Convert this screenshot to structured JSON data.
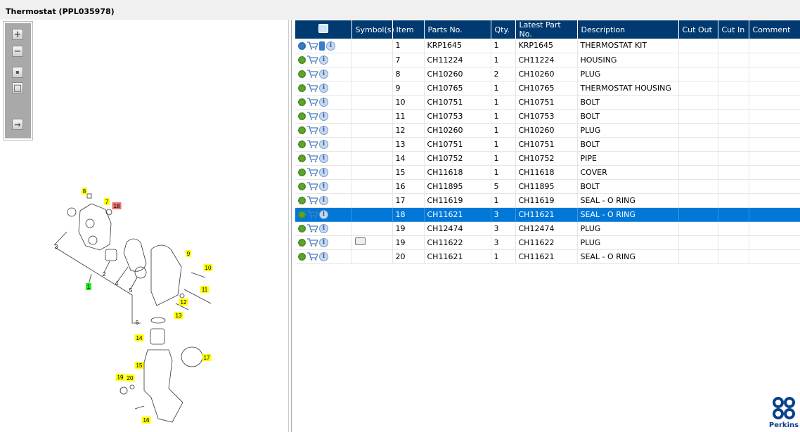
{
  "window": {
    "title": "Thermostat (PPL035978)"
  },
  "toolbar": {
    "buttons": [
      {
        "name": "zoom-in",
        "glyph": "+"
      },
      {
        "name": "zoom-out",
        "glyph": "−"
      },
      {
        "name": "fit",
        "glyph": "▪"
      },
      {
        "name": "actual-size",
        "glyph": "□"
      },
      {
        "name": "export",
        "glyph": "→"
      }
    ]
  },
  "grid": {
    "columns": [
      "",
      "Symbol(s)",
      "Item",
      "Parts No.",
      "Qty.",
      "Latest Part No.",
      "Description",
      "Cut Out",
      "Cut In",
      "Comment"
    ],
    "rows": [
      {
        "item": "1",
        "part": "KRP1645",
        "qty": "1",
        "latest": "KRP1645",
        "desc": "THERMOSTAT KIT",
        "kit": true
      },
      {
        "item": "7",
        "part": "CH11224",
        "qty": "1",
        "latest": "CH11224",
        "desc": "HOUSING"
      },
      {
        "item": "8",
        "part": "CH10260",
        "qty": "2",
        "latest": "CH10260",
        "desc": "PLUG"
      },
      {
        "item": "9",
        "part": "CH10765",
        "qty": "1",
        "latest": "CH10765",
        "desc": "THERMOSTAT HOUSING"
      },
      {
        "item": "10",
        "part": "CH10751",
        "qty": "1",
        "latest": "CH10751",
        "desc": "BOLT"
      },
      {
        "item": "11",
        "part": "CH10753",
        "qty": "1",
        "latest": "CH10753",
        "desc": "BOLT"
      },
      {
        "item": "12",
        "part": "CH10260",
        "qty": "1",
        "latest": "CH10260",
        "desc": "PLUG"
      },
      {
        "item": "13",
        "part": "CH10751",
        "qty": "1",
        "latest": "CH10751",
        "desc": "BOLT"
      },
      {
        "item": "14",
        "part": "CH10752",
        "qty": "1",
        "latest": "CH10752",
        "desc": "PIPE"
      },
      {
        "item": "15",
        "part": "CH11618",
        "qty": "1",
        "latest": "CH11618",
        "desc": "COVER"
      },
      {
        "item": "16",
        "part": "CH11895",
        "qty": "5",
        "latest": "CH11895",
        "desc": "BOLT"
      },
      {
        "item": "17",
        "part": "CH11619",
        "qty": "1",
        "latest": "CH11619",
        "desc": "SEAL - O RING"
      },
      {
        "item": "18",
        "part": "CH11621",
        "qty": "3",
        "latest": "CH11621",
        "desc": "SEAL - O RING",
        "selected": true
      },
      {
        "item": "19",
        "part": "CH12474",
        "qty": "3",
        "latest": "CH12474",
        "desc": "PLUG"
      },
      {
        "item": "19",
        "part": "CH11622",
        "qty": "3",
        "latest": "CH11622",
        "desc": "PLUG",
        "symbol": true
      },
      {
        "item": "20",
        "part": "CH11621",
        "qty": "1",
        "latest": "CH11621",
        "desc": "SEAL - O RING"
      }
    ]
  },
  "diagram": {
    "callouts": [
      {
        "t": "8",
        "c": "#ffff00"
      },
      {
        "t": "7",
        "c": "#ffff00"
      },
      {
        "t": "18",
        "c": "#f07070"
      },
      {
        "t": "1",
        "c": "#22ee22"
      },
      {
        "t": "9",
        "c": "#ffff00"
      },
      {
        "t": "10",
        "c": "#ffff00"
      },
      {
        "t": "11",
        "c": "#ffff00"
      },
      {
        "t": "12",
        "c": "#ffff00"
      },
      {
        "t": "13",
        "c": "#ffff00"
      },
      {
        "t": "14",
        "c": "#ffff00"
      },
      {
        "t": "15",
        "c": "#ffff00"
      },
      {
        "t": "17",
        "c": "#ffff00"
      },
      {
        "t": "19",
        "c": "#ffff00"
      },
      {
        "t": "20",
        "c": "#ffff00"
      },
      {
        "t": "16",
        "c": "#ffff00"
      },
      {
        "t": "3",
        "c": ""
      },
      {
        "t": "2",
        "c": ""
      },
      {
        "t": "4",
        "c": ""
      },
      {
        "t": "5",
        "c": ""
      },
      {
        "t": "6",
        "c": ""
      }
    ]
  },
  "logo": {
    "text": "Perkins"
  },
  "colors": {
    "header": "#003a70",
    "selected": "#0078d7"
  }
}
